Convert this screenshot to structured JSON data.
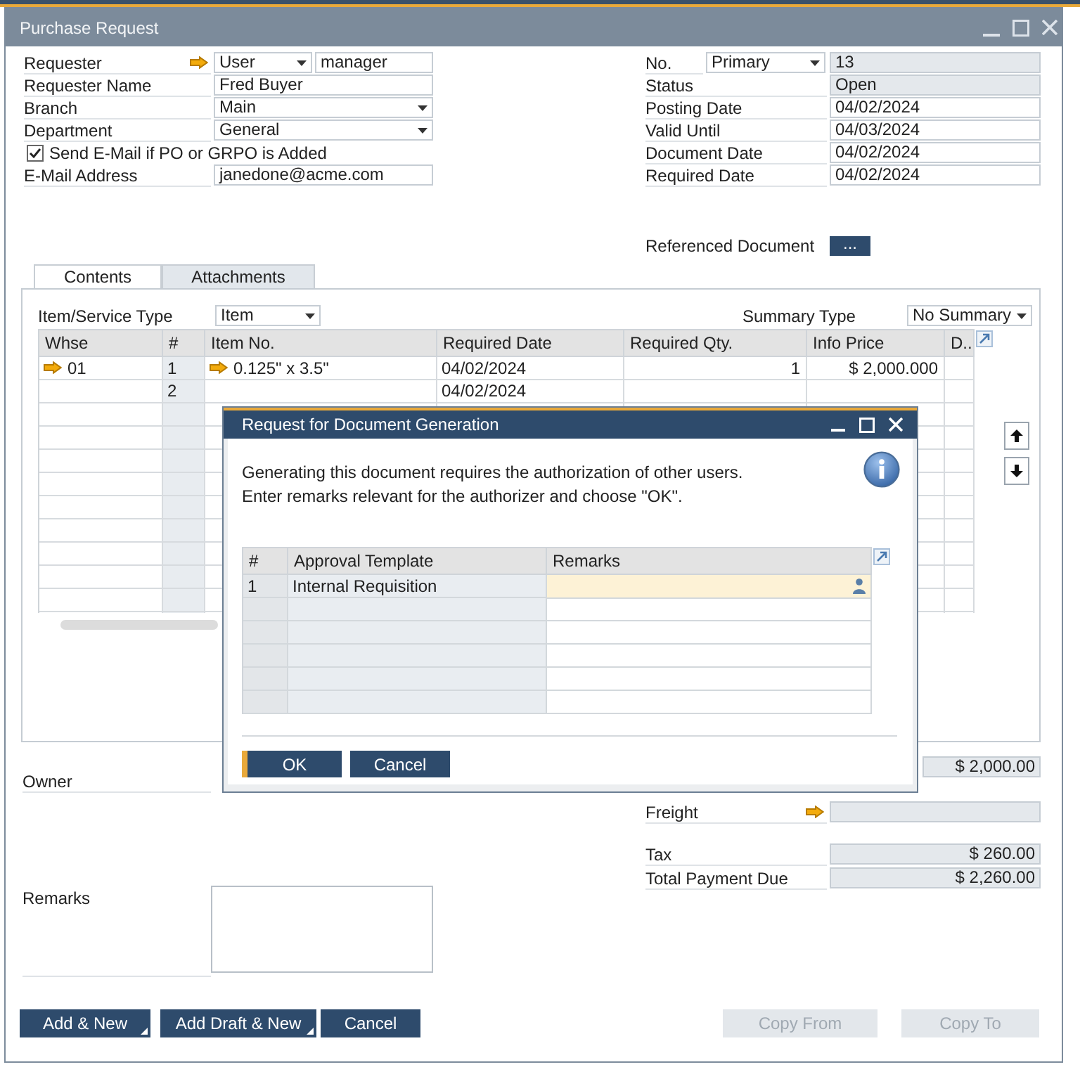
{
  "window": {
    "title": "Purchase Request"
  },
  "header_left": [
    {
      "kind": "user",
      "label": "Requester",
      "type": "User",
      "value": "manager"
    },
    {
      "kind": "text",
      "label": "Requester Name",
      "value": "Fred Buyer"
    },
    {
      "kind": "select",
      "label": "Branch",
      "value": "Main"
    },
    {
      "kind": "select",
      "label": "Department",
      "value": "General"
    },
    {
      "kind": "checkbox",
      "label": "Send E-Mail if PO or GRPO is Added",
      "checked": true
    },
    {
      "kind": "text",
      "label": "E-Mail Address",
      "value": "janedone@acme.com"
    }
  ],
  "header_right": [
    {
      "kind": "series",
      "label": "No.",
      "series": "Primary",
      "value": "13",
      "readonly": true
    },
    {
      "kind": "text",
      "label": "Status",
      "value": "Open",
      "readonly": true
    },
    {
      "kind": "text",
      "label": "Posting Date",
      "value": "04/02/2024",
      "readonly": false
    },
    {
      "kind": "text",
      "label": "Valid Until",
      "value": "04/03/2024",
      "readonly": false
    },
    {
      "kind": "text",
      "label": "Document Date",
      "value": "04/02/2024",
      "readonly": false
    },
    {
      "kind": "text",
      "label": "Required Date",
      "value": "04/02/2024",
      "readonly": false
    }
  ],
  "referenced_document": {
    "label": "Referenced Document",
    "button": "..."
  },
  "tabs": [
    {
      "label": "Contents",
      "selected": true
    },
    {
      "label": "Attachments",
      "selected": false
    }
  ],
  "item_service_type": {
    "label": "Item/Service Type",
    "value": "Item"
  },
  "summary_type": {
    "label": "Summary Type",
    "value": "No Summary"
  },
  "table": {
    "columns": [
      {
        "label": "Whse",
        "kind": "link"
      },
      {
        "label": "#",
        "kind": "number"
      },
      {
        "label": "Item No.",
        "kind": "link"
      },
      {
        "label": "Required Date",
        "kind": "text"
      },
      {
        "label": "Required Qty.",
        "kind": "amount"
      },
      {
        "label": "Info Price",
        "kind": "amount"
      },
      {
        "label": "D..",
        "kind": "text"
      }
    ],
    "rows": [
      {
        "whse": "01",
        "number": "1",
        "item_no": "0.125\" x 3.5\"",
        "required_date": "04/02/2024",
        "required_qty": "1",
        "info_price": "$ 2,000.000"
      },
      {
        "number": "2",
        "required_date": "04/02/2024"
      }
    ]
  },
  "owner": {
    "label": "Owner"
  },
  "remarks": {
    "label": "Remarks"
  },
  "totals": [
    {
      "kind": "amount",
      "value": "$ 2,000.00"
    },
    {
      "kind": "link",
      "label": "Freight"
    },
    {
      "kind": "amount",
      "label": "Tax",
      "value": "$ 260.00"
    },
    {
      "kind": "amount",
      "label": "Total Payment Due",
      "value": "$ 2,260.00"
    }
  ],
  "buttons_left": [
    {
      "label": "Add & New",
      "menu": true,
      "disabled": false
    },
    {
      "label": "Add Draft & New",
      "menu": true,
      "disabled": false
    },
    {
      "label": "Cancel",
      "menu": false,
      "disabled": false
    }
  ],
  "buttons_right": [
    {
      "label": "Copy From",
      "menu": false,
      "disabled": true
    },
    {
      "label": "Copy To",
      "menu": false,
      "disabled": true
    }
  ],
  "dialog": {
    "title": "Request for Document Generation",
    "message": [
      "Generating this document requires the authorization of other users.",
      "Enter remarks relevant for the authorizer and choose \"OK\"."
    ],
    "table": {
      "columns": [
        {
          "label": "#",
          "kind": "number"
        },
        {
          "label": "Approval Template",
          "kind": "readonly"
        },
        {
          "label": "Remarks",
          "kind": "editable"
        }
      ],
      "rows": [
        {
          "number": "1",
          "approval_template": "Internal Requisition",
          "focused": true
        }
      ]
    },
    "buttons": [
      {
        "label": "OK",
        "default": true
      },
      {
        "label": "Cancel",
        "default": false
      }
    ]
  }
}
